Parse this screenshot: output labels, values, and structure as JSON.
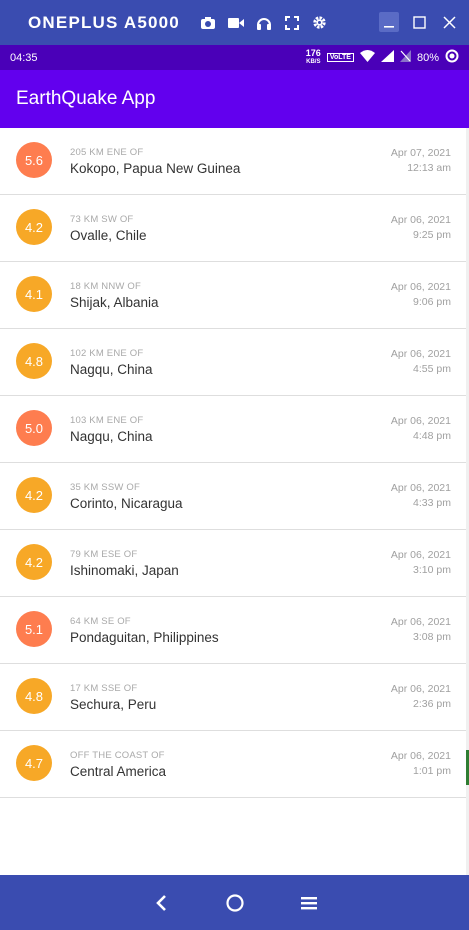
{
  "window": {
    "device_name": "ONEPLUS A5000",
    "tool_icons": [
      "camera-icon",
      "video-icon",
      "headphones-icon",
      "fullscreen-icon",
      "gear-icon"
    ]
  },
  "status_bar": {
    "time": "04:35",
    "net_speed": "176",
    "net_unit": "KB/S",
    "volte": "VoLTE",
    "battery": "80%"
  },
  "app_bar": {
    "title": "EarthQuake App"
  },
  "colors": {
    "mag_orange_red": "#fe7d4f",
    "mag_amber": "#f7a827",
    "app_bar": "#6200ee",
    "status_bar": "#4a00b8",
    "window_bar": "#3a4cb0"
  },
  "quakes": [
    {
      "mag": "5.6",
      "offset": "205 KM ENE OF",
      "place": "Kokopo, Papua New Guinea",
      "date": "Apr 07, 2021",
      "time": "12:13 am",
      "color": "#fe7d4f"
    },
    {
      "mag": "4.2",
      "offset": "73 KM SW OF",
      "place": "Ovalle, Chile",
      "date": "Apr 06, 2021",
      "time": "9:25 pm",
      "color": "#f7a827"
    },
    {
      "mag": "4.1",
      "offset": "18 KM NNW OF",
      "place": "Shijak, Albania",
      "date": "Apr 06, 2021",
      "time": "9:06 pm",
      "color": "#f7a827"
    },
    {
      "mag": "4.8",
      "offset": "102 KM ENE OF",
      "place": "Nagqu, China",
      "date": "Apr 06, 2021",
      "time": "4:55 pm",
      "color": "#f7a827"
    },
    {
      "mag": "5.0",
      "offset": "103 KM ENE OF",
      "place": "Nagqu, China",
      "date": "Apr 06, 2021",
      "time": "4:48 pm",
      "color": "#fe7d4f"
    },
    {
      "mag": "4.2",
      "offset": "35 KM SSW OF",
      "place": "Corinto, Nicaragua",
      "date": "Apr 06, 2021",
      "time": "4:33 pm",
      "color": "#f7a827"
    },
    {
      "mag": "4.2",
      "offset": "79 KM ESE OF",
      "place": "Ishinomaki, Japan",
      "date": "Apr 06, 2021",
      "time": "3:10 pm",
      "color": "#f7a827"
    },
    {
      "mag": "5.1",
      "offset": "64 KM SE OF",
      "place": "Pondaguitan, Philippines",
      "date": "Apr 06, 2021",
      "time": "3:08 pm",
      "color": "#fe7d4f"
    },
    {
      "mag": "4.8",
      "offset": "17 KM SSE OF",
      "place": "Sechura, Peru",
      "date": "Apr 06, 2021",
      "time": "2:36 pm",
      "color": "#f7a827"
    },
    {
      "mag": "4.7",
      "offset": "OFF THE COAST OF",
      "place": "Central America",
      "date": "Apr 06, 2021",
      "time": "1:01 pm",
      "color": "#f7a827"
    }
  ],
  "nav_bar": {
    "icons": [
      "back-icon",
      "home-icon",
      "menu-icon"
    ]
  }
}
